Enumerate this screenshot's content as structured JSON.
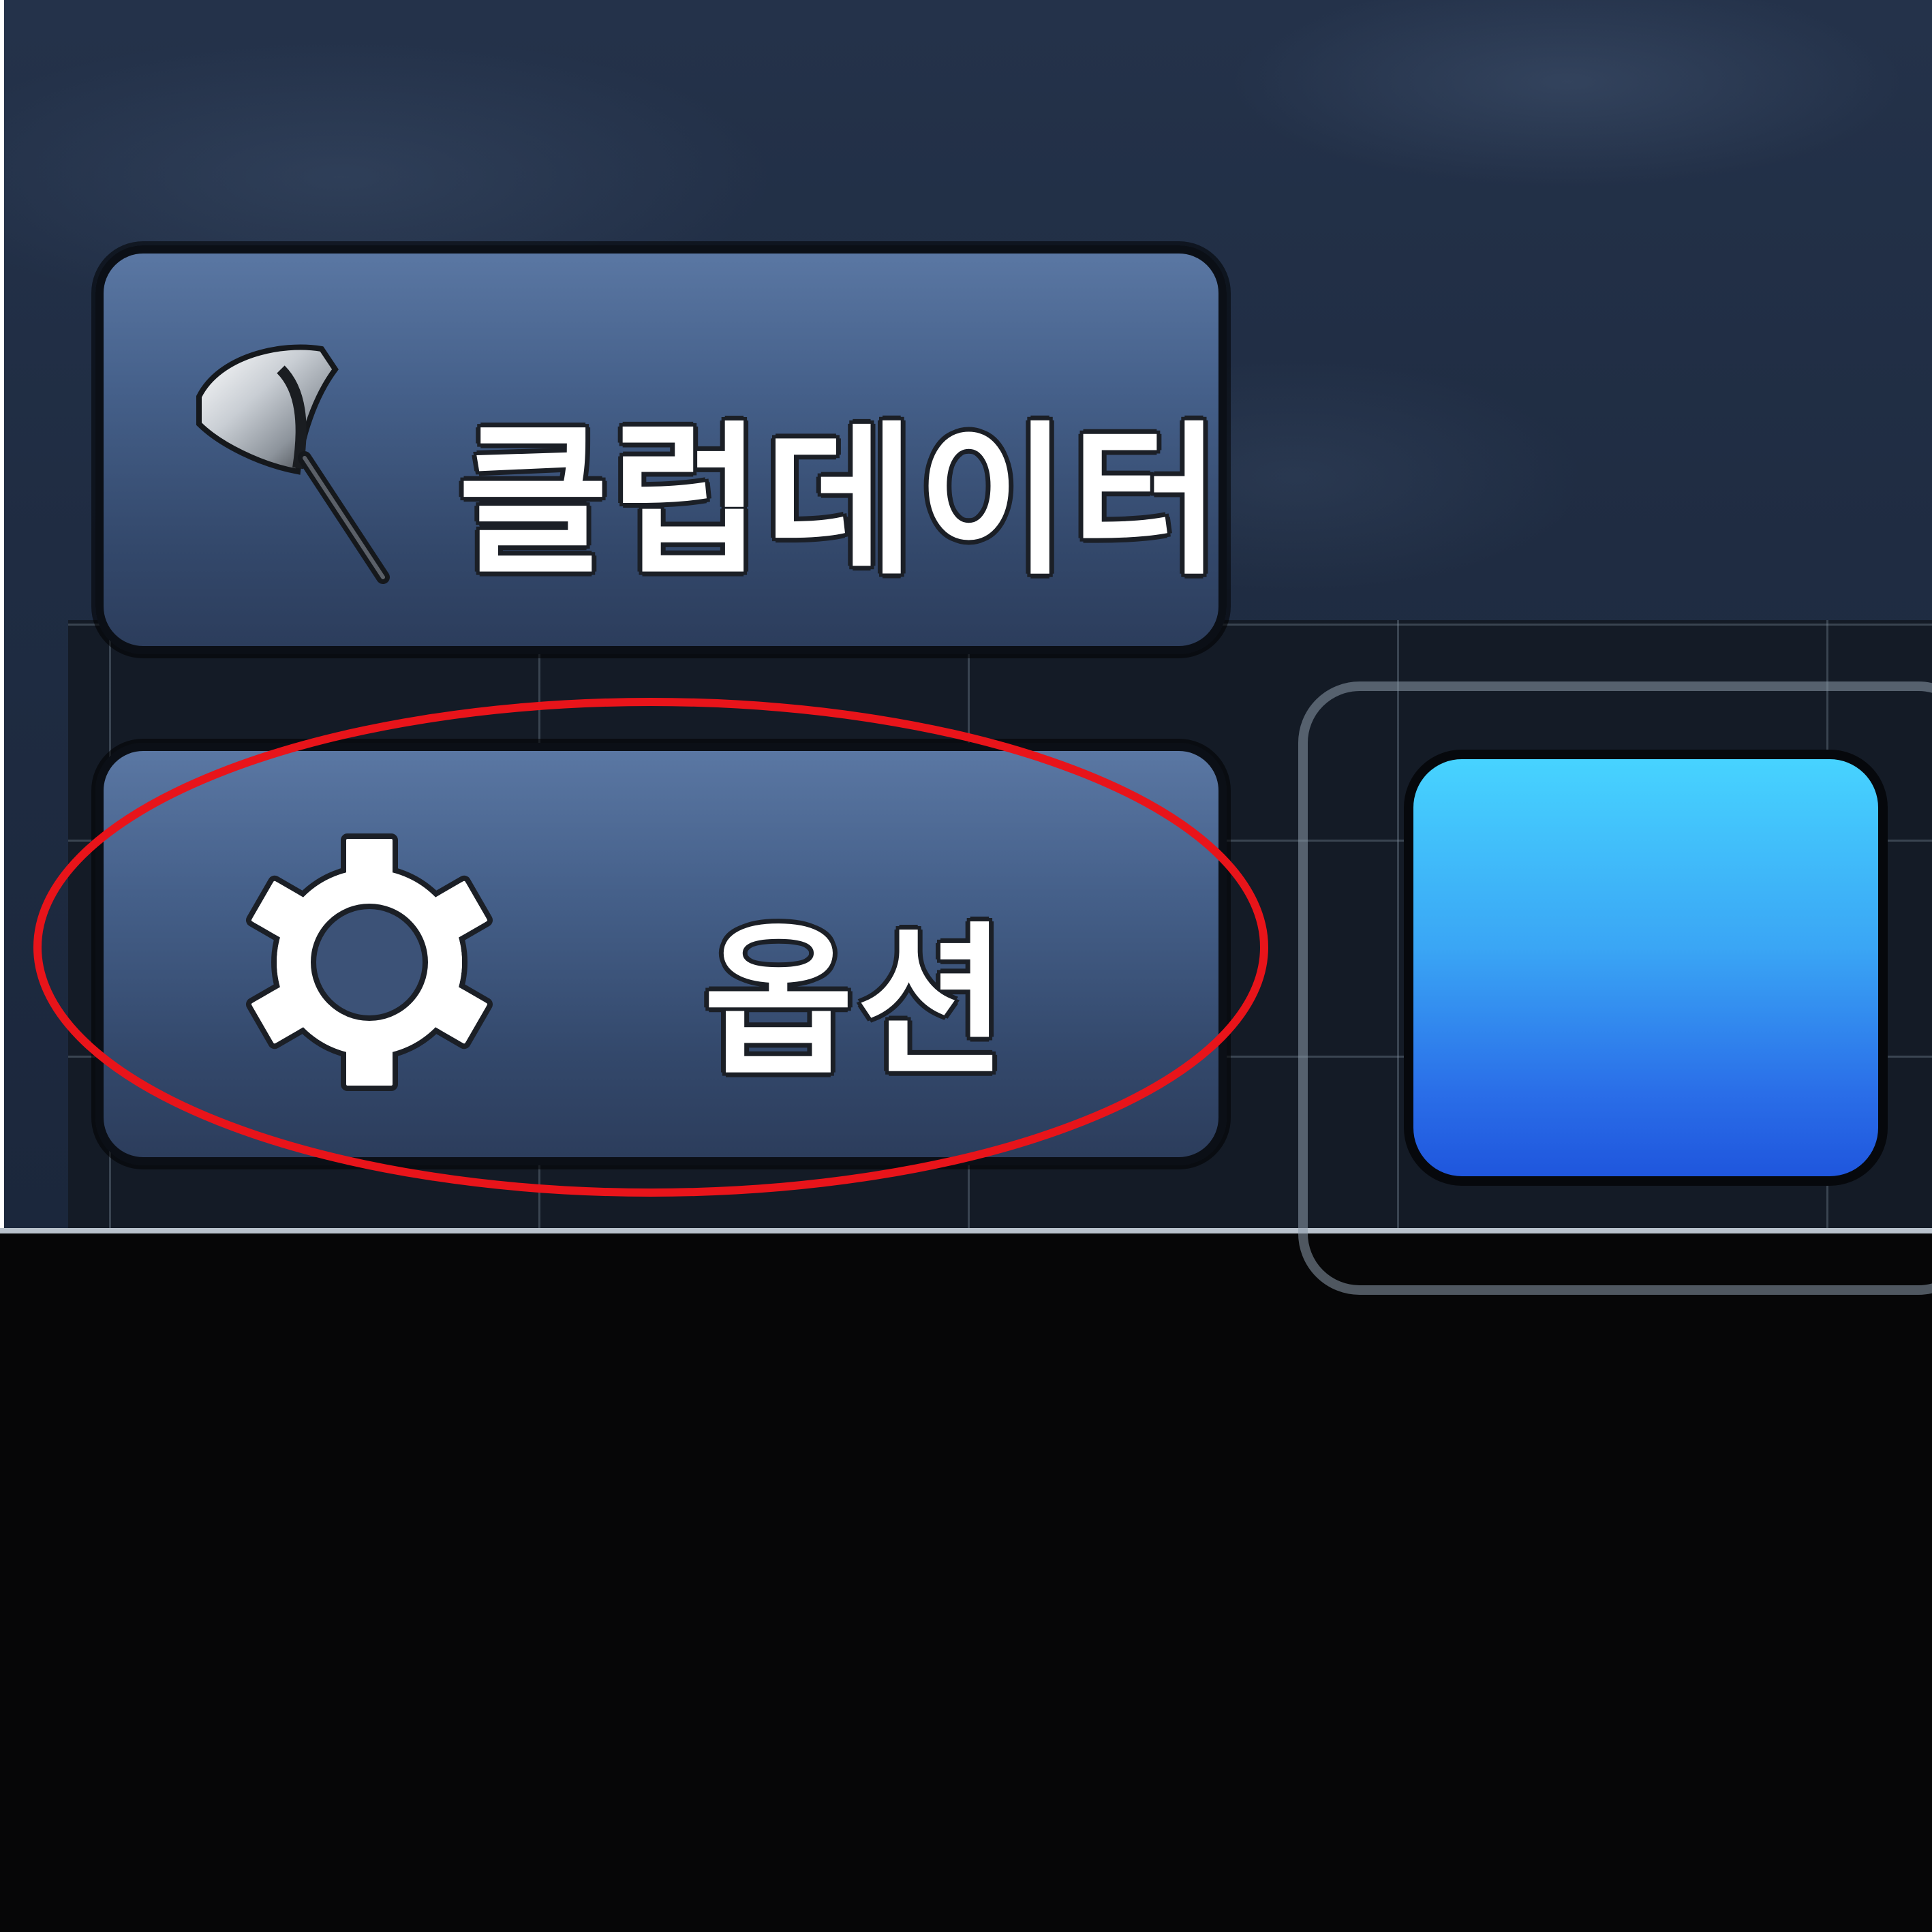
{
  "menu": {
    "club_data_label": "클럽데이터",
    "options_label": "옵션"
  },
  "icons": {
    "club": "golf-driver-icon",
    "options": "gear-icon"
  },
  "colors": {
    "button_top": "#5a77a3",
    "button_bottom": "#2c3d5c",
    "accent_blue_top": "#47d3ff",
    "accent_blue_bottom": "#1f56dd",
    "annotation": "#e8141a"
  }
}
